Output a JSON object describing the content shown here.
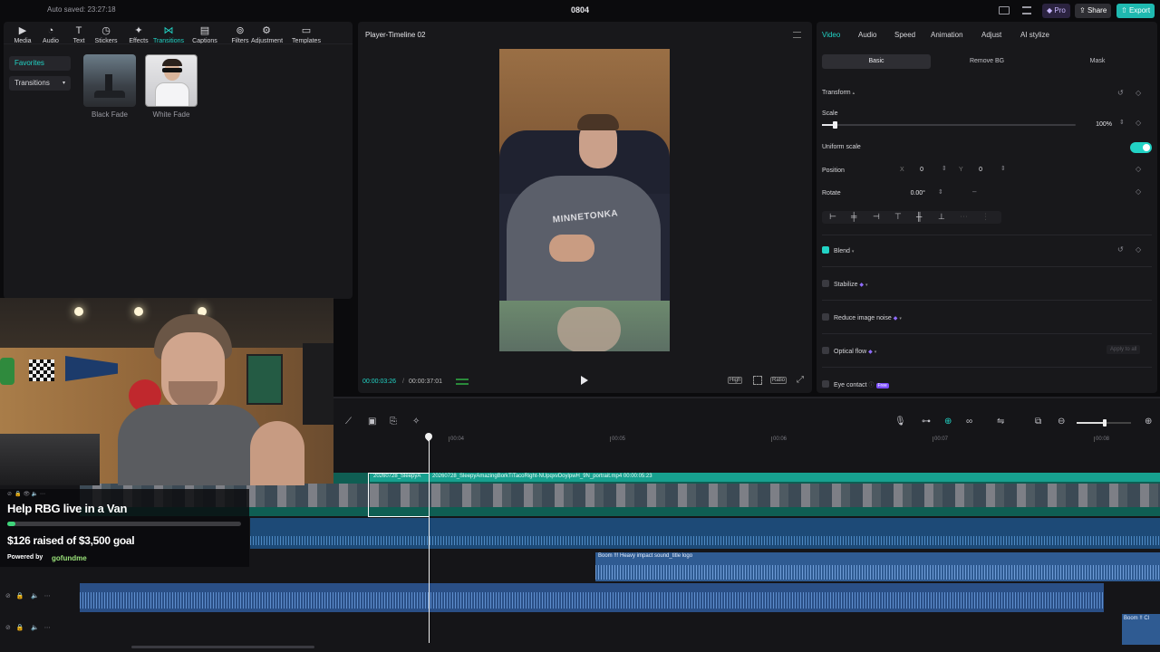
{
  "topbar": {
    "autosave": "Auto saved: 23:27:18",
    "project_title": "0804",
    "pro_label": "Pro",
    "share_label": "Share",
    "export_label": "Export"
  },
  "tools": [
    {
      "label": "Media",
      "icon": "media-icon"
    },
    {
      "label": "Audio",
      "icon": "audio-icon"
    },
    {
      "label": "Text",
      "icon": "text-icon"
    },
    {
      "label": "Stickers",
      "icon": "stickers-icon"
    },
    {
      "label": "Effects",
      "icon": "effects-icon"
    },
    {
      "label": "Transitions",
      "icon": "transitions-icon"
    },
    {
      "label": "Captions",
      "icon": "captions-icon"
    },
    {
      "label": "Filters",
      "icon": "filters-icon"
    },
    {
      "label": "Adjustment",
      "icon": "adjustment-icon"
    },
    {
      "label": "Templates",
      "icon": "templates-icon"
    }
  ],
  "left": {
    "favorites": "Favorites",
    "transitions_dropdown": "Transitions",
    "items": [
      {
        "label": "Black Fade"
      },
      {
        "label": "White Fade"
      }
    ]
  },
  "player": {
    "title": "Player-Timeline 02",
    "current_time": "00:00:03:26",
    "total_time": "00:00:37:01",
    "quality": "High",
    "ratio": "Ratio",
    "shirt_text": "MINNETONKA"
  },
  "props": {
    "tabs": [
      "Video",
      "Audio",
      "Speed",
      "Animation",
      "Adjust",
      "AI stylize"
    ],
    "segments": [
      "Basic",
      "Remove BG",
      "Mask"
    ],
    "transform_label": "Transform",
    "scale_label": "Scale",
    "scale_value": "100%",
    "scale_fraction": 0.05,
    "uniform_scale": "Uniform scale",
    "position_label": "Position",
    "pos_x_label": "X",
    "pos_x": "0",
    "pos_y_label": "Y",
    "pos_y": "0",
    "rotate_label": "Rotate",
    "rotate_value": "0.00°",
    "blend": "Blend",
    "stabilize": "Stabilize",
    "reduce_noise": "Reduce image noise",
    "optical_flow": "Optical flow",
    "apply_all": "Apply to all",
    "eye_contact": "Eye contact",
    "free_badge": "Free"
  },
  "timeline": {
    "ruler": [
      "00:04",
      "00:05",
      "00:06",
      "00:07",
      "00:08"
    ],
    "clip1_label": "20260728_SleepyA",
    "clip2_label": "20260728_SleepyAmazingBorkTiTacoRight-NUpqxvDoylpwH_9N_portrait.mp4   00:00:05:23",
    "sfx_label": "Boom !!! Heavy impact sound_title logo",
    "sfx2_label": "Boom !! Cl"
  },
  "overlay": {
    "title": "Help RBG live in a Van",
    "raised": "$126 raised of $3,500 goal",
    "progress": 0.036,
    "powered": "Powered by",
    "brand": "gofundme"
  },
  "colors": {
    "accent": "#22d3c5",
    "export_bg": "#1fb9b0",
    "pro_bg": "#6b3fd6",
    "video_track": "#16a085",
    "audio_track": "#2a4f86"
  }
}
